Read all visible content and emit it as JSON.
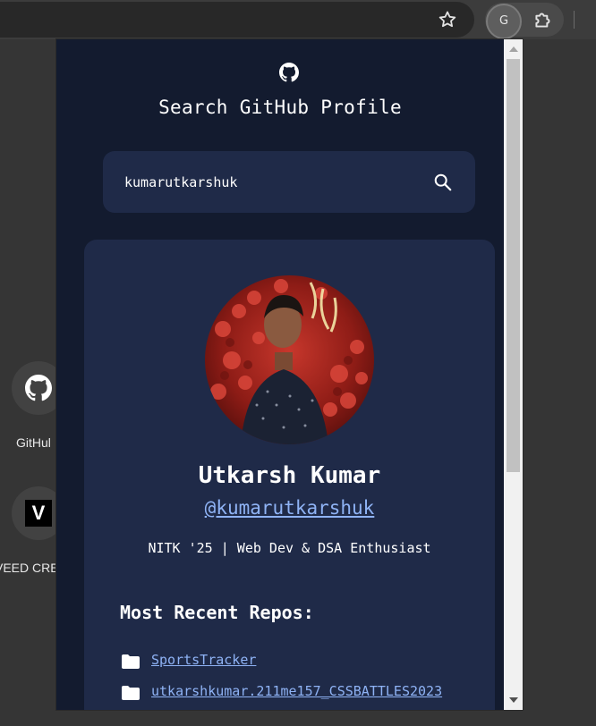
{
  "browser": {
    "extension_avatar_letter": "G"
  },
  "shortcuts": [
    {
      "label": "GitHul",
      "icon": "github-icon"
    },
    {
      "label": "VEED CRE",
      "icon": "veed-logo-icon",
      "logo_letter": "V"
    }
  ],
  "popup": {
    "title": "Search GitHub Profile",
    "search": {
      "value": "kumarutkarshuk",
      "placeholder": ""
    },
    "profile": {
      "name": "Utkarsh Kumar",
      "handle": "@kumarutkarshuk",
      "bio": "NITK '25 | Web Dev & DSA Enthusiast"
    },
    "repos_heading": "Most Recent Repos:",
    "repos": [
      {
        "name": "SportsTracker"
      },
      {
        "name": "utkarshkumar.211me157_CSSBATTLES2023"
      }
    ]
  },
  "colors": {
    "popup_bg": "#131b2f",
    "card_bg": "#1f2a48",
    "link": "#8fb3f5",
    "text": "#ffffff"
  }
}
